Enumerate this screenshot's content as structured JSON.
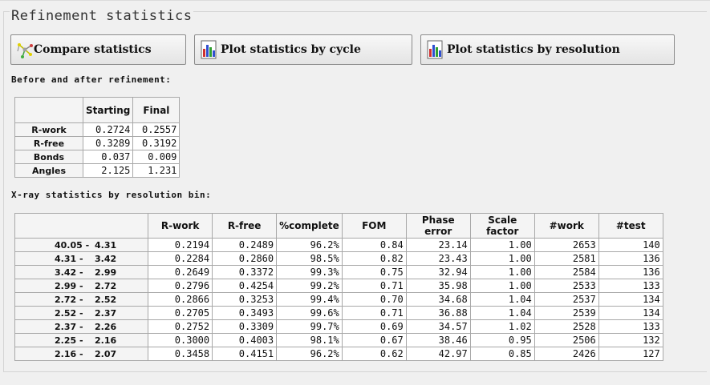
{
  "group_title": "Refinement statistics",
  "buttons": {
    "compare": "Compare statistics",
    "plot_cycle": "Plot statistics by cycle",
    "plot_resolution": "Plot statistics by resolution"
  },
  "before_after": {
    "label": "Before and after refinement:",
    "columns": [
      "Starting",
      "Final"
    ],
    "rows": [
      {
        "name": "R-work",
        "starting": "0.2724",
        "final": "0.2557"
      },
      {
        "name": "R-free",
        "starting": "0.3289",
        "final": "0.3192"
      },
      {
        "name": "Bonds",
        "starting": "0.037",
        "final": "0.009"
      },
      {
        "name": "Angles",
        "starting": "2.125",
        "final": "1.231"
      }
    ]
  },
  "xray": {
    "label": "X-ray statistics by resolution bin:",
    "columns": [
      "R-work",
      "R-free",
      "%complete",
      "FOM",
      "Phase error",
      "Scale factor",
      "#work",
      "#test"
    ],
    "rows": [
      {
        "lo": "40.05 -",
        "hi": "4.31",
        "rwork": "0.2194",
        "rfree": "0.2489",
        "complete": "96.2%",
        "fom": "0.84",
        "phase": "23.14",
        "scale": "1.00",
        "nwork": "2653",
        "ntest": "140"
      },
      {
        "lo": "4.31 -",
        "hi": "3.42",
        "rwork": "0.2284",
        "rfree": "0.2860",
        "complete": "98.5%",
        "fom": "0.82",
        "phase": "23.43",
        "scale": "1.00",
        "nwork": "2581",
        "ntest": "136"
      },
      {
        "lo": "3.42 -",
        "hi": "2.99",
        "rwork": "0.2649",
        "rfree": "0.3372",
        "complete": "99.3%",
        "fom": "0.75",
        "phase": "32.94",
        "scale": "1.00",
        "nwork": "2584",
        "ntest": "136"
      },
      {
        "lo": "2.99 -",
        "hi": "2.72",
        "rwork": "0.2796",
        "rfree": "0.4254",
        "complete": "99.2%",
        "fom": "0.71",
        "phase": "35.98",
        "scale": "1.00",
        "nwork": "2533",
        "ntest": "133"
      },
      {
        "lo": "2.72 -",
        "hi": "2.52",
        "rwork": "0.2866",
        "rfree": "0.3253",
        "complete": "99.4%",
        "fom": "0.70",
        "phase": "34.68",
        "scale": "1.04",
        "nwork": "2537",
        "ntest": "134"
      },
      {
        "lo": "2.52 -",
        "hi": "2.37",
        "rwork": "0.2705",
        "rfree": "0.3493",
        "complete": "99.6%",
        "fom": "0.71",
        "phase": "36.88",
        "scale": "1.04",
        "nwork": "2539",
        "ntest": "134"
      },
      {
        "lo": "2.37 -",
        "hi": "2.26",
        "rwork": "0.2752",
        "rfree": "0.3309",
        "complete": "99.7%",
        "fom": "0.69",
        "phase": "34.57",
        "scale": "1.02",
        "nwork": "2528",
        "ntest": "133"
      },
      {
        "lo": "2.25 -",
        "hi": "2.16",
        "rwork": "0.3000",
        "rfree": "0.4003",
        "complete": "98.1%",
        "fom": "0.67",
        "phase": "38.46",
        "scale": "0.95",
        "nwork": "2506",
        "ntest": "132"
      },
      {
        "lo": "2.16 -",
        "hi": "2.07",
        "rwork": "0.3458",
        "rfree": "0.4151",
        "complete": "96.2%",
        "fom": "0.62",
        "phase": "42.97",
        "scale": "0.85",
        "nwork": "2426",
        "ntest": "127"
      }
    ]
  },
  "icons": {
    "compare": "molecule-icon",
    "plot": "bar-chart-icon"
  }
}
